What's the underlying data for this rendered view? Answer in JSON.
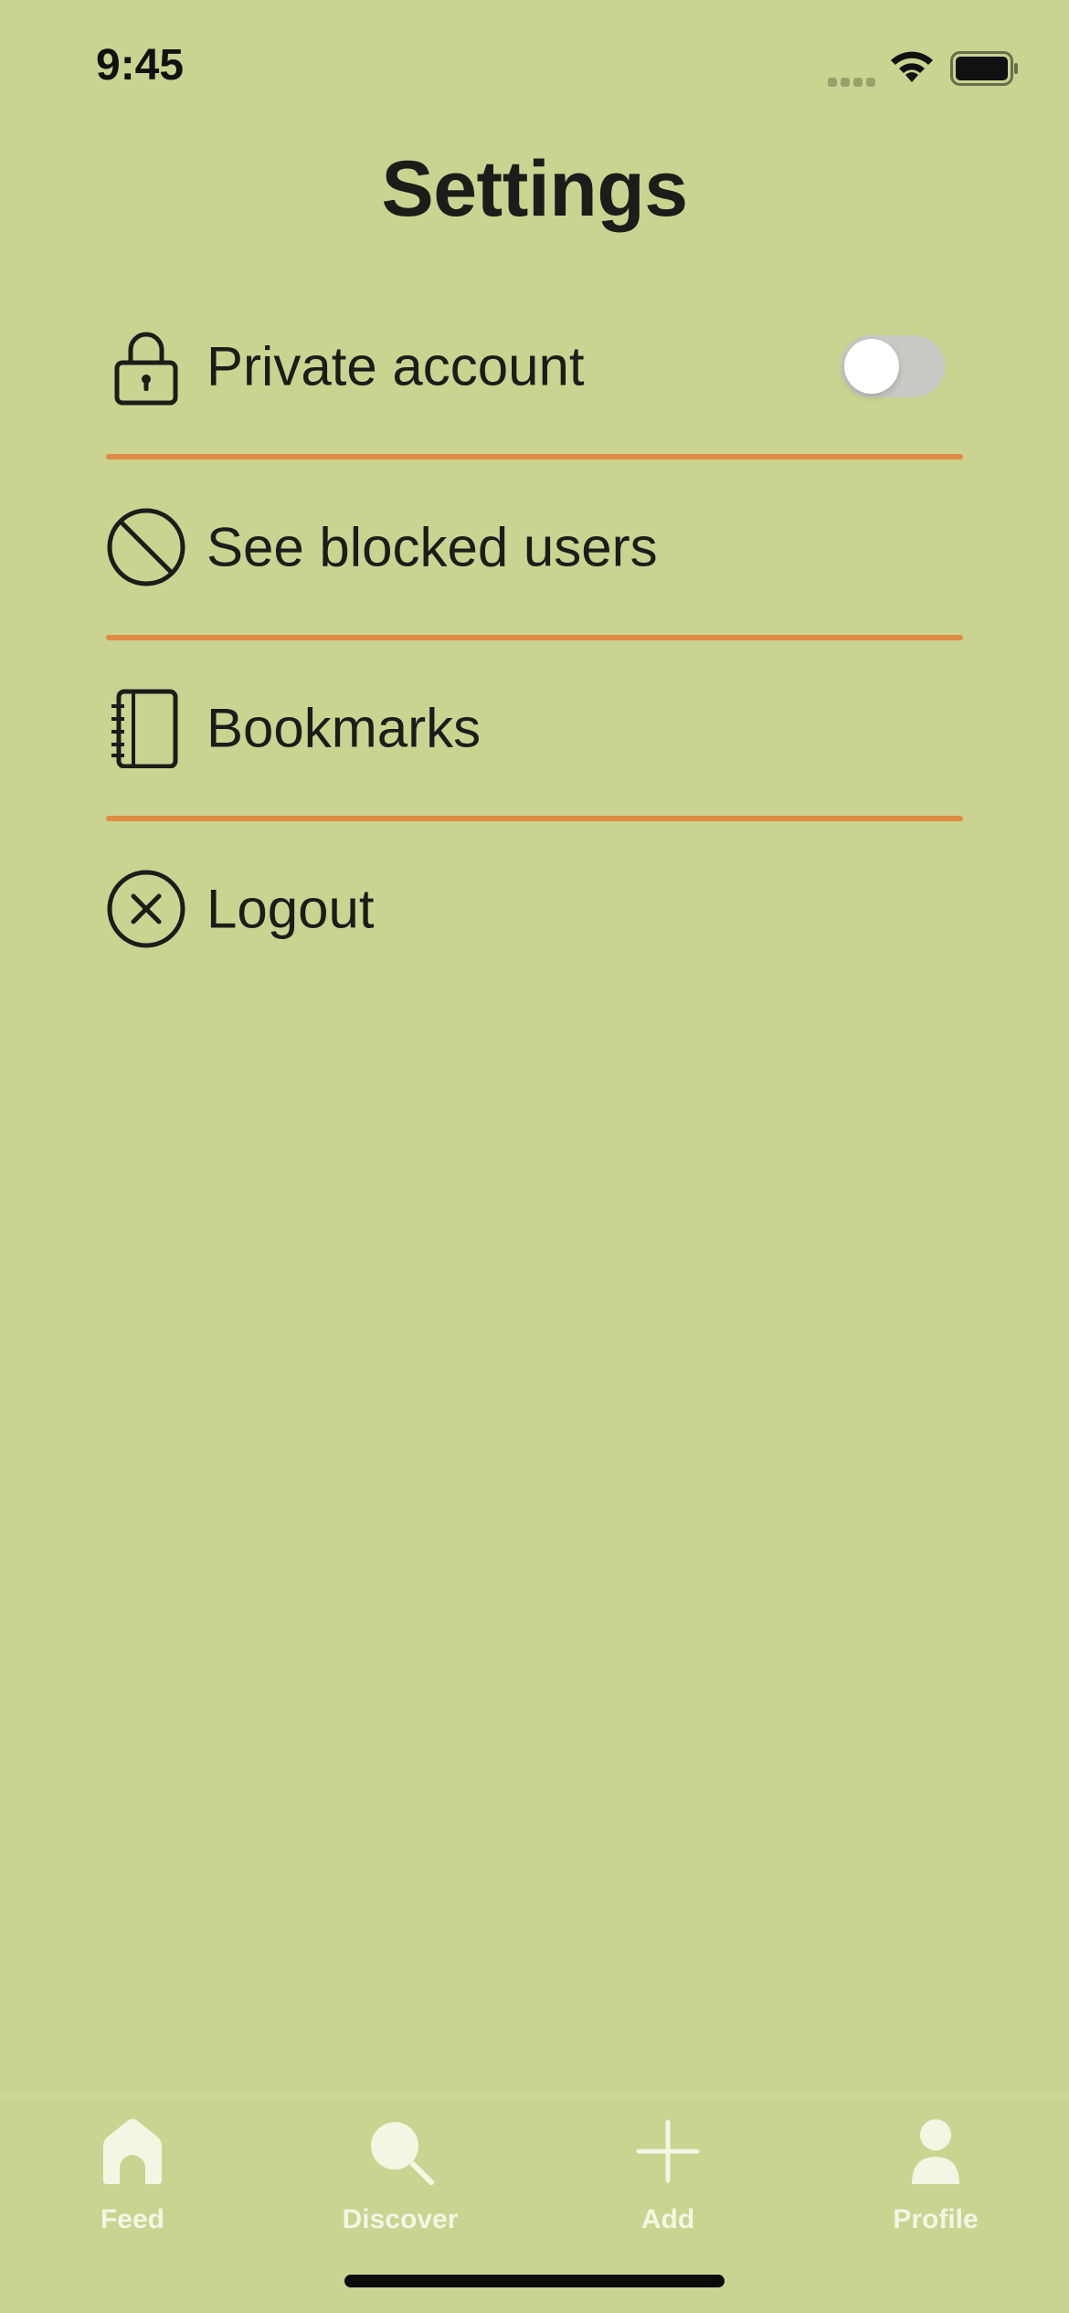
{
  "status_bar": {
    "time": "9:45",
    "icons": [
      "cellular-signal-icon",
      "wifi-icon",
      "battery-icon"
    ]
  },
  "header": {
    "title": "Settings"
  },
  "settings": {
    "items": [
      {
        "label": "Private account",
        "icon": "lock-icon",
        "has_toggle": true,
        "toggle_on": false
      },
      {
        "label": "See blocked users",
        "icon": "blocked-icon"
      },
      {
        "label": "Bookmarks",
        "icon": "notebook-icon"
      },
      {
        "label": "Logout",
        "icon": "close-circle-icon"
      }
    ]
  },
  "tab_bar": {
    "tabs": [
      {
        "label": "Feed",
        "icon": "home-icon"
      },
      {
        "label": "Discover",
        "icon": "search-icon"
      },
      {
        "label": "Add",
        "icon": "plus-icon"
      },
      {
        "label": "Profile",
        "icon": "person-icon"
      }
    ]
  },
  "colors": {
    "background": "#cbd391",
    "divider": "#e08b45",
    "text": "#1c1c1a",
    "tab_label": "#f4f6e4",
    "toggle_off": "#c9c9c5"
  }
}
